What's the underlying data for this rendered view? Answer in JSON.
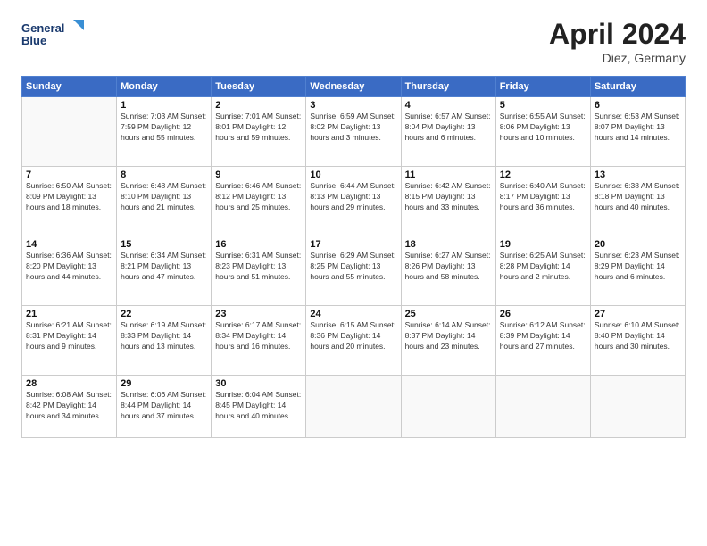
{
  "logo": {
    "line1": "General",
    "line2": "Blue"
  },
  "title": "April 2024",
  "subtitle": "Diez, Germany",
  "weekdays": [
    "Sunday",
    "Monday",
    "Tuesday",
    "Wednesday",
    "Thursday",
    "Friday",
    "Saturday"
  ],
  "weeks": [
    [
      {
        "day": "",
        "info": ""
      },
      {
        "day": "1",
        "info": "Sunrise: 7:03 AM\nSunset: 7:59 PM\nDaylight: 12 hours\nand 55 minutes."
      },
      {
        "day": "2",
        "info": "Sunrise: 7:01 AM\nSunset: 8:01 PM\nDaylight: 12 hours\nand 59 minutes."
      },
      {
        "day": "3",
        "info": "Sunrise: 6:59 AM\nSunset: 8:02 PM\nDaylight: 13 hours\nand 3 minutes."
      },
      {
        "day": "4",
        "info": "Sunrise: 6:57 AM\nSunset: 8:04 PM\nDaylight: 13 hours\nand 6 minutes."
      },
      {
        "day": "5",
        "info": "Sunrise: 6:55 AM\nSunset: 8:06 PM\nDaylight: 13 hours\nand 10 minutes."
      },
      {
        "day": "6",
        "info": "Sunrise: 6:53 AM\nSunset: 8:07 PM\nDaylight: 13 hours\nand 14 minutes."
      }
    ],
    [
      {
        "day": "7",
        "info": "Sunrise: 6:50 AM\nSunset: 8:09 PM\nDaylight: 13 hours\nand 18 minutes."
      },
      {
        "day": "8",
        "info": "Sunrise: 6:48 AM\nSunset: 8:10 PM\nDaylight: 13 hours\nand 21 minutes."
      },
      {
        "day": "9",
        "info": "Sunrise: 6:46 AM\nSunset: 8:12 PM\nDaylight: 13 hours\nand 25 minutes."
      },
      {
        "day": "10",
        "info": "Sunrise: 6:44 AM\nSunset: 8:13 PM\nDaylight: 13 hours\nand 29 minutes."
      },
      {
        "day": "11",
        "info": "Sunrise: 6:42 AM\nSunset: 8:15 PM\nDaylight: 13 hours\nand 33 minutes."
      },
      {
        "day": "12",
        "info": "Sunrise: 6:40 AM\nSunset: 8:17 PM\nDaylight: 13 hours\nand 36 minutes."
      },
      {
        "day": "13",
        "info": "Sunrise: 6:38 AM\nSunset: 8:18 PM\nDaylight: 13 hours\nand 40 minutes."
      }
    ],
    [
      {
        "day": "14",
        "info": "Sunrise: 6:36 AM\nSunset: 8:20 PM\nDaylight: 13 hours\nand 44 minutes."
      },
      {
        "day": "15",
        "info": "Sunrise: 6:34 AM\nSunset: 8:21 PM\nDaylight: 13 hours\nand 47 minutes."
      },
      {
        "day": "16",
        "info": "Sunrise: 6:31 AM\nSunset: 8:23 PM\nDaylight: 13 hours\nand 51 minutes."
      },
      {
        "day": "17",
        "info": "Sunrise: 6:29 AM\nSunset: 8:25 PM\nDaylight: 13 hours\nand 55 minutes."
      },
      {
        "day": "18",
        "info": "Sunrise: 6:27 AM\nSunset: 8:26 PM\nDaylight: 13 hours\nand 58 minutes."
      },
      {
        "day": "19",
        "info": "Sunrise: 6:25 AM\nSunset: 8:28 PM\nDaylight: 14 hours\nand 2 minutes."
      },
      {
        "day": "20",
        "info": "Sunrise: 6:23 AM\nSunset: 8:29 PM\nDaylight: 14 hours\nand 6 minutes."
      }
    ],
    [
      {
        "day": "21",
        "info": "Sunrise: 6:21 AM\nSunset: 8:31 PM\nDaylight: 14 hours\nand 9 minutes."
      },
      {
        "day": "22",
        "info": "Sunrise: 6:19 AM\nSunset: 8:33 PM\nDaylight: 14 hours\nand 13 minutes."
      },
      {
        "day": "23",
        "info": "Sunrise: 6:17 AM\nSunset: 8:34 PM\nDaylight: 14 hours\nand 16 minutes."
      },
      {
        "day": "24",
        "info": "Sunrise: 6:15 AM\nSunset: 8:36 PM\nDaylight: 14 hours\nand 20 minutes."
      },
      {
        "day": "25",
        "info": "Sunrise: 6:14 AM\nSunset: 8:37 PM\nDaylight: 14 hours\nand 23 minutes."
      },
      {
        "day": "26",
        "info": "Sunrise: 6:12 AM\nSunset: 8:39 PM\nDaylight: 14 hours\nand 27 minutes."
      },
      {
        "day": "27",
        "info": "Sunrise: 6:10 AM\nSunset: 8:40 PM\nDaylight: 14 hours\nand 30 minutes."
      }
    ],
    [
      {
        "day": "28",
        "info": "Sunrise: 6:08 AM\nSunset: 8:42 PM\nDaylight: 14 hours\nand 34 minutes."
      },
      {
        "day": "29",
        "info": "Sunrise: 6:06 AM\nSunset: 8:44 PM\nDaylight: 14 hours\nand 37 minutes."
      },
      {
        "day": "30",
        "info": "Sunrise: 6:04 AM\nSunset: 8:45 PM\nDaylight: 14 hours\nand 40 minutes."
      },
      {
        "day": "",
        "info": ""
      },
      {
        "day": "",
        "info": ""
      },
      {
        "day": "",
        "info": ""
      },
      {
        "day": "",
        "info": ""
      }
    ]
  ]
}
